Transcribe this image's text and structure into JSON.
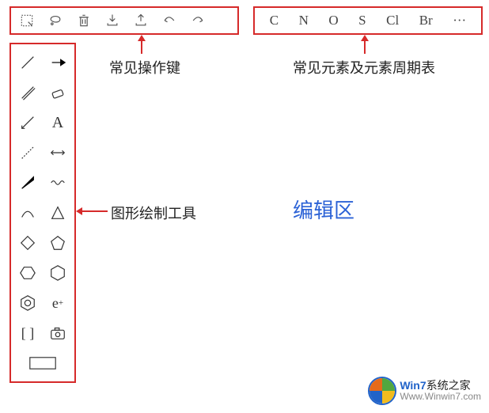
{
  "toolbar": {
    "items": [
      {
        "name": "marquee",
        "kind": "icon"
      },
      {
        "name": "lasso",
        "kind": "icon"
      },
      {
        "name": "trash",
        "kind": "icon"
      },
      {
        "name": "import",
        "kind": "icon"
      },
      {
        "name": "export",
        "kind": "icon"
      },
      {
        "name": "undo",
        "kind": "icon"
      },
      {
        "name": "redo",
        "kind": "icon"
      }
    ]
  },
  "elements": {
    "items": [
      "C",
      "N",
      "O",
      "S",
      "Cl",
      "Br",
      "···"
    ]
  },
  "side_tools": {
    "items": [
      {
        "name": "line-solid"
      },
      {
        "name": "arrow-solid"
      },
      {
        "name": "line-double"
      },
      {
        "name": "eraser"
      },
      {
        "name": "line-slashes"
      },
      {
        "name": "text",
        "glyph": "A"
      },
      {
        "name": "line-dashed"
      },
      {
        "name": "line-arrow-both"
      },
      {
        "name": "wedge-solid"
      },
      {
        "name": "wavy"
      },
      {
        "name": "arc"
      },
      {
        "name": "triangle"
      },
      {
        "name": "diamond"
      },
      {
        "name": "pentagon"
      },
      {
        "name": "hexagon"
      },
      {
        "name": "hexagon-alt"
      },
      {
        "name": "benzene"
      },
      {
        "name": "eplus",
        "glyph": "e⁺"
      },
      {
        "name": "brackets",
        "glyph": "[ ]"
      },
      {
        "name": "camera"
      },
      {
        "name": "rectangle",
        "span": 2
      }
    ]
  },
  "annotations": {
    "top_toolbar": "常见操作键",
    "elements_panel": "常见元素及元素周期表",
    "side_tools": "图形绘制工具",
    "editor_area": "编辑区"
  },
  "watermark": {
    "brand": "Win7",
    "title_suffix": "系统之家",
    "url": "Www.Winwin7.com"
  },
  "colors": {
    "highlight": "#d62a2a",
    "link": "#2b62d6"
  }
}
